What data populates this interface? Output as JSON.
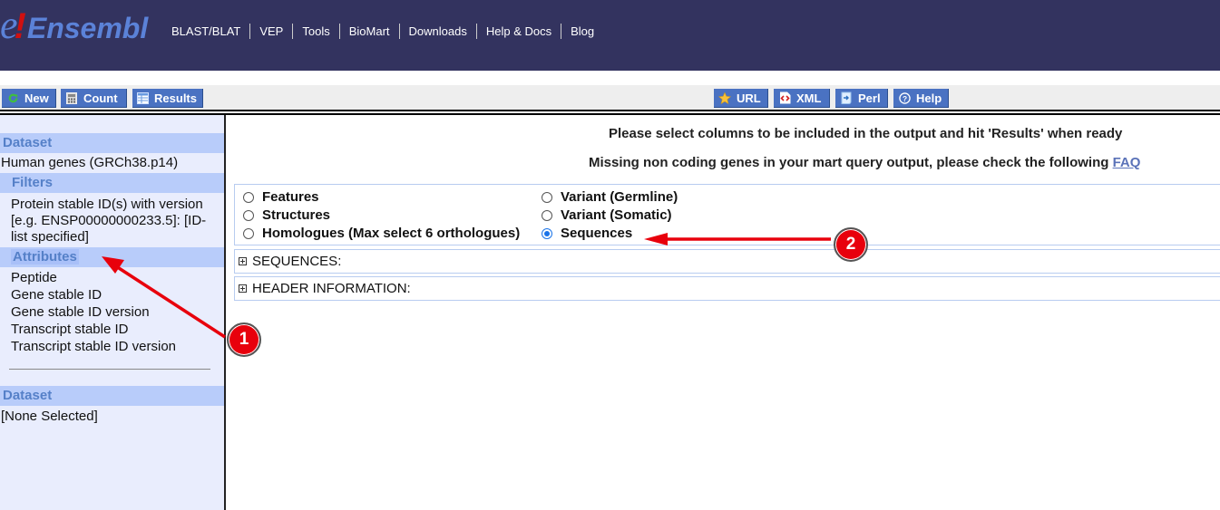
{
  "header": {
    "logo": {
      "e": "e",
      "bang": "!",
      "word": "Ensembl"
    },
    "nav": [
      "BLAST/BLAT",
      "VEP",
      "Tools",
      "BioMart",
      "Downloads",
      "Help & Docs",
      "Blog"
    ]
  },
  "toolbar": {
    "left": [
      {
        "label": "New",
        "icon": "refresh-icon"
      },
      {
        "label": "Count",
        "icon": "calculator-icon"
      },
      {
        "label": "Results",
        "icon": "table-icon"
      }
    ],
    "right": [
      {
        "label": "URL",
        "icon": "star-icon"
      },
      {
        "label": "XML",
        "icon": "xml-icon"
      },
      {
        "label": "Perl",
        "icon": "perl-script-icon"
      },
      {
        "label": "Help",
        "icon": "help-icon"
      }
    ]
  },
  "sidebar": {
    "dataset_heading": "Dataset",
    "dataset_value": "Human genes (GRCh38.p14)",
    "filters_heading": "Filters",
    "filters_lines": [
      "Protein stable ID(s) with version",
      "[e.g. ENSP00000000233.5]: [ID-",
      "list specified]"
    ],
    "attributes_heading": "Attributes",
    "attributes": [
      "Peptide",
      "Gene stable ID",
      "Gene stable ID version",
      "Transcript stable ID",
      "Transcript stable ID version"
    ],
    "dataset2_heading": "Dataset",
    "dataset2_value": "[None Selected]"
  },
  "main": {
    "instruction": "Please select columns to be included in the output and hit 'Results' when ready",
    "notice": "Missing non coding genes in your mart query output, please check the following",
    "notice_link": "FAQ",
    "attribute_pages": [
      {
        "label": "Features",
        "checked": false
      },
      {
        "label": "Structures",
        "checked": false
      },
      {
        "label": "Homologues (Max select 6 orthologues)",
        "checked": false
      },
      {
        "label": "Variant (Germline)",
        "checked": false
      },
      {
        "label": "Variant (Somatic)",
        "checked": false
      },
      {
        "label": "Sequences",
        "checked": true
      }
    ],
    "sections": [
      "SEQUENCES:",
      "HEADER INFORMATION:"
    ]
  },
  "annotations": {
    "badge1": "1",
    "badge2": "2",
    "color": "#e8000c"
  }
}
